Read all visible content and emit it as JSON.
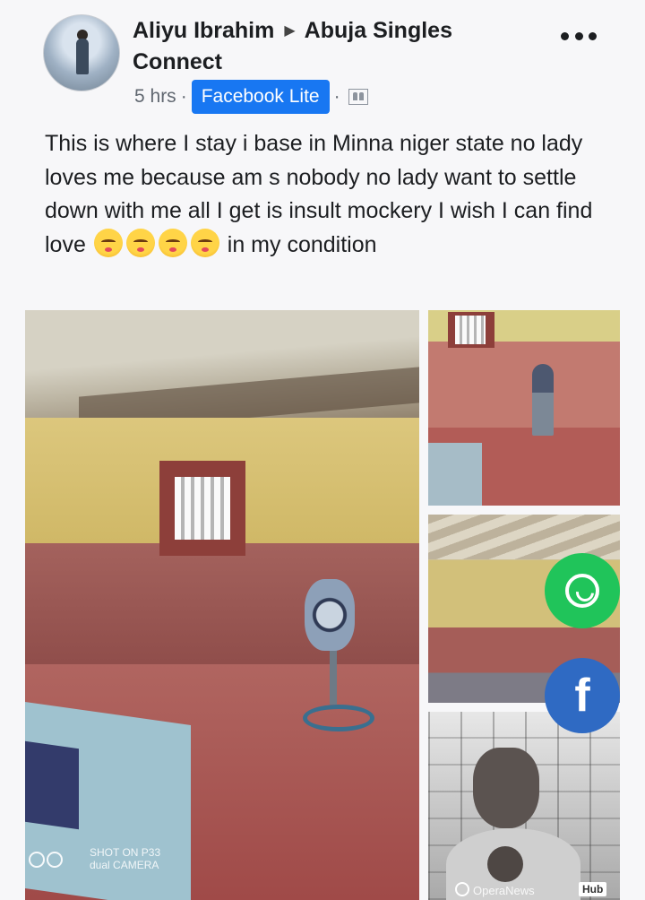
{
  "post": {
    "author": "Aliyu Ibrahim",
    "group": "Abuja Singles Connect",
    "time": "5 hrs",
    "app_badge": "Facebook Lite",
    "text_before_emoji": "This is where I stay i base in Minna niger state no lady loves me because am s nobody no lady want to settle down with me all I get is insult mockery I wish I can find love",
    "text_after_emoji": "in my condition",
    "emoji_count": 4,
    "emoji_name": "crying-face-emoji"
  },
  "photos": {
    "camera_watermark_line1": "SHOT ON P33",
    "camera_watermark_line2": "dual CAMERA",
    "opera_watermark": "OperaNews",
    "opera_hub": "Hub"
  },
  "icons": {
    "more": "more-horizontal-icon",
    "privacy": "group-privacy-icon",
    "whatsapp": "whatsapp-icon",
    "facebook": "facebook-icon"
  },
  "share": {
    "facebook_glyph": "f"
  },
  "colors": {
    "accent_blue": "#1877f2",
    "whatsapp_green": "#20c45a",
    "facebook_blue": "#2f6ac3"
  }
}
